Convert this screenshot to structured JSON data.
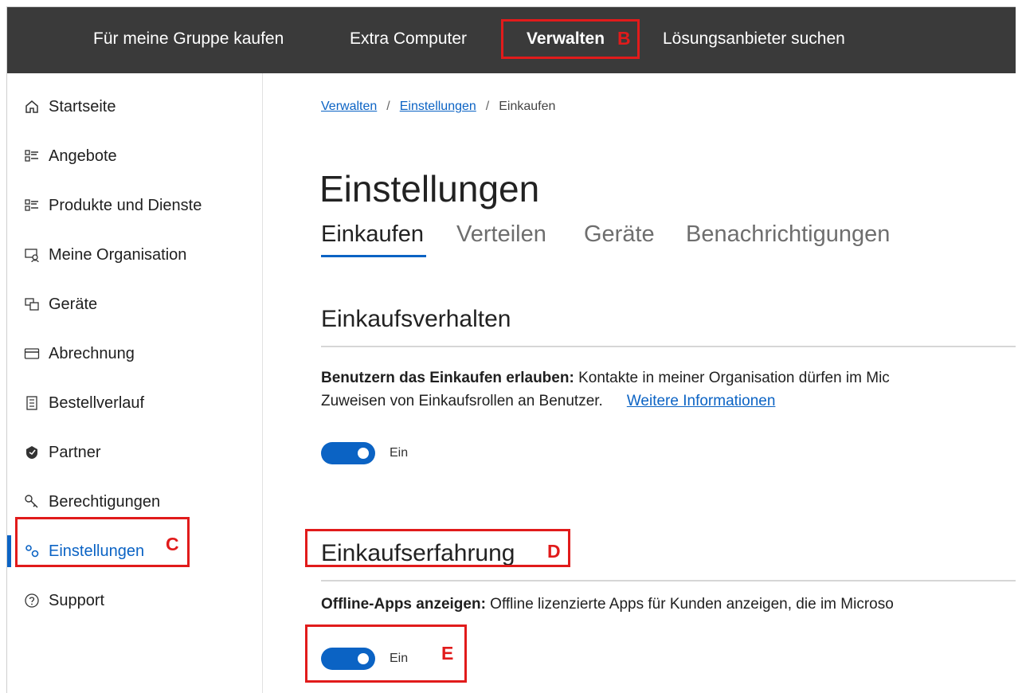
{
  "topnav": {
    "items": [
      {
        "label": "Für meine Gruppe kaufen"
      },
      {
        "label": "Extra Computer"
      },
      {
        "label": "Verwalten"
      },
      {
        "label": "Lösungsanbieter suchen"
      }
    ]
  },
  "sidebar": {
    "items": [
      {
        "label": "Startseite",
        "icon": "home-icon"
      },
      {
        "label": "Angebote",
        "icon": "list-icon"
      },
      {
        "label": "Produkte und Dienste",
        "icon": "list-icon"
      },
      {
        "label": "Meine Organisation",
        "icon": "organization-icon"
      },
      {
        "label": "Geräte",
        "icon": "devices-icon"
      },
      {
        "label": "Abrechnung",
        "icon": "credit-card-icon"
      },
      {
        "label": "Bestellverlauf",
        "icon": "order-history-icon"
      },
      {
        "label": "Partner",
        "icon": "partner-icon"
      },
      {
        "label": "Berechtigungen",
        "icon": "key-icon"
      },
      {
        "label": "Einstellungen",
        "icon": "settings-icon"
      },
      {
        "label": "Support",
        "icon": "help-icon"
      }
    ]
  },
  "breadcrumb": {
    "items": [
      "Verwalten",
      "Einstellungen",
      "Einkaufen"
    ],
    "separator": "/"
  },
  "page": {
    "title": "Einstellungen",
    "tabs": [
      {
        "label": "Einkaufen"
      },
      {
        "label": "Verteilen"
      },
      {
        "label": "Geräte"
      },
      {
        "label": "Benachrichtigungen"
      }
    ]
  },
  "sections": [
    {
      "title": "Einkaufsverhalten",
      "setting_bold": "Benutzern das Einkaufen erlauben:",
      "setting_text": " Kontakte in meiner Organisation dürfen im Mic",
      "setting_text2": "Zuweisen von Einkaufsrollen an Benutzer.",
      "link": "Weitere Informationen",
      "toggle_label": "Ein"
    },
    {
      "title": "Einkaufserfahrung",
      "setting_bold": "Offline-Apps anzeigen:",
      "setting_text": " Offline lizenzierte Apps für Kunden anzeigen, die im Microso",
      "toggle_label": "Ein"
    }
  ],
  "annotations": {
    "b": "B",
    "c": "C",
    "d": "D",
    "e": "E"
  },
  "colors": {
    "accent": "#0b63c4",
    "annotation": "#e11b1b",
    "topbar": "#3a3a3a"
  }
}
